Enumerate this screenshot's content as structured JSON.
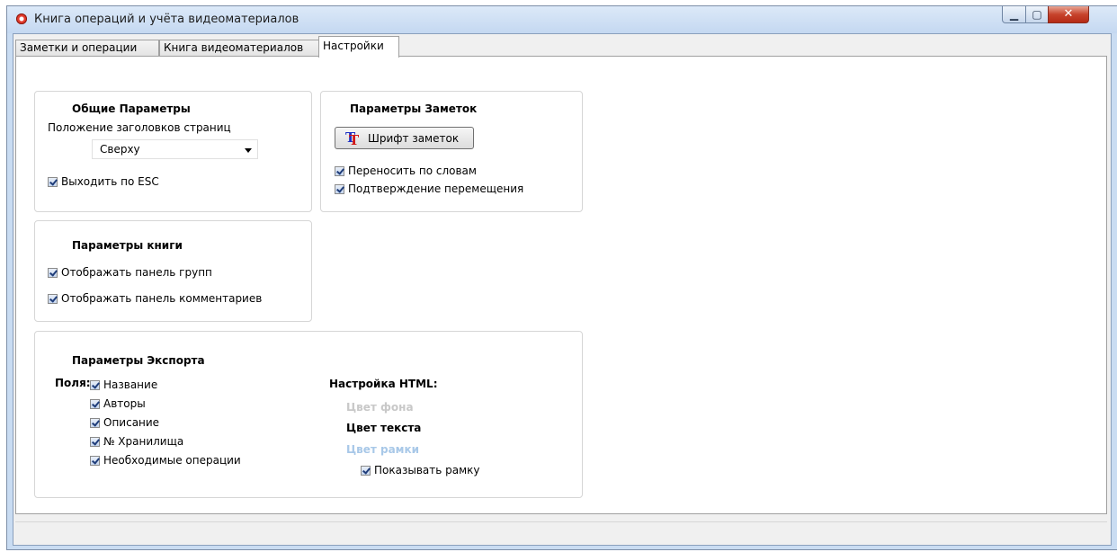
{
  "window": {
    "title": "Книга операций и учёта видеоматериалов",
    "buttons": {
      "minimize": "▁",
      "maximize": "▢",
      "close": "✕"
    }
  },
  "tabs": [
    {
      "label": "Заметки и операции",
      "active": false
    },
    {
      "label": "Книга видеоматериалов",
      "active": false
    },
    {
      "label": "Настройки",
      "active": true
    }
  ],
  "general": {
    "title": "Общие  Параметры",
    "tab_position_label": "Положение заголовков страниц",
    "tab_position_value": "Сверху",
    "exit_esc": {
      "label": "Выходить по ESC",
      "checked": true
    }
  },
  "notes": {
    "title": "Параметры Заметок",
    "font_button": "Шрифт заметок",
    "font_icon": "text-font-icon",
    "word_wrap": {
      "label": "Переносить по  словам",
      "checked": true
    },
    "confirm_move": {
      "label": "Подтверждение перемещения",
      "checked": true
    }
  },
  "book": {
    "title": "Параметры книги",
    "show_groups": {
      "label": "Отображать панель групп",
      "checked": true
    },
    "show_comments": {
      "label": "Отображать панель комментариев",
      "checked": true
    }
  },
  "export": {
    "title": "Параметры Экспорта",
    "fields_label": "Поля:",
    "fields": [
      {
        "label": "Название",
        "checked": true
      },
      {
        "label": "Авторы",
        "checked": true
      },
      {
        "label": "Описание",
        "checked": true
      },
      {
        "label": "№ Хранилища",
        "checked": true
      },
      {
        "label": "Необходимые операции",
        "checked": true
      }
    ],
    "html": {
      "title": "Настройка HTML:",
      "bg_color_label": "Цвет фона",
      "text_color_label": "Цвет текста",
      "border_color_label": "Цвет рамки",
      "show_border": {
        "label": "Показывать рамку",
        "checked": true
      }
    }
  },
  "colors": {
    "bg_color_label": "#c8c8c8",
    "text_color_label": "#000000",
    "border_color_label": "#a8c8e8"
  }
}
